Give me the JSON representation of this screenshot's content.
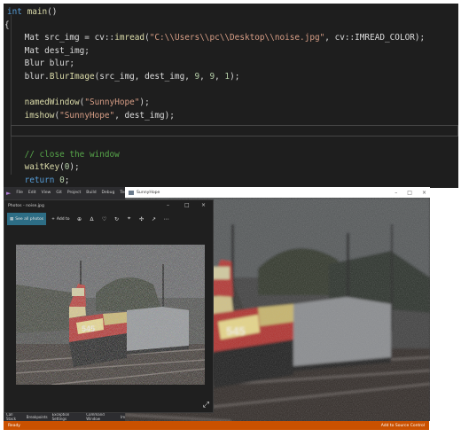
{
  "editor": {
    "lines": [
      {
        "toks": [
          [
            "kw",
            "int "
          ],
          [
            "fn",
            "main"
          ],
          [
            "txt",
            "()"
          ]
        ]
      },
      {
        "toks": [
          [
            "txt",
            "{"
          ]
        ]
      },
      {
        "toks": [
          [
            "txt",
            "    Mat src_img = cv::"
          ],
          [
            "fn",
            "imread"
          ],
          [
            "txt",
            "("
          ],
          [
            "str",
            "\"C:\\\\Users\\\\pc\\\\Desktop\\\\noise.jpg\""
          ],
          [
            "txt",
            ", cv::IMREAD_COLOR);"
          ]
        ]
      },
      {
        "toks": [
          [
            "txt",
            "    Mat dest_img;"
          ]
        ]
      },
      {
        "toks": [
          [
            "txt",
            "    Blur blur;"
          ]
        ]
      },
      {
        "toks": [
          [
            "txt",
            "    blur."
          ],
          [
            "fn",
            "BlurImage"
          ],
          [
            "txt",
            "(src_img, dest_img, "
          ],
          [
            "num",
            "9"
          ],
          [
            "txt",
            ", "
          ],
          [
            "num",
            "9"
          ],
          [
            "txt",
            ", "
          ],
          [
            "num",
            "1"
          ],
          [
            "txt",
            ");"
          ]
        ]
      },
      {
        "toks": [
          [
            "txt",
            ""
          ]
        ]
      },
      {
        "toks": [
          [
            "txt",
            "    "
          ],
          [
            "fn",
            "namedWindow"
          ],
          [
            "txt",
            "("
          ],
          [
            "str",
            "\"SunnyHope\""
          ],
          [
            "txt",
            ");"
          ]
        ]
      },
      {
        "toks": [
          [
            "txt",
            "    "
          ],
          [
            "fn",
            "imshow"
          ],
          [
            "txt",
            "("
          ],
          [
            "str",
            "\"SunnyHope\""
          ],
          [
            "txt",
            ", dest_img);"
          ]
        ]
      },
      {
        "toks": [
          [
            "txt",
            ""
          ]
        ]
      },
      {
        "toks": [
          [
            "txt",
            ""
          ]
        ]
      },
      {
        "toks": [
          [
            "txt",
            "    "
          ],
          [
            "cm",
            "// close the window"
          ]
        ]
      },
      {
        "toks": [
          [
            "txt",
            "    "
          ],
          [
            "fn",
            "waitKey"
          ],
          [
            "txt",
            "("
          ],
          [
            "num",
            "0"
          ],
          [
            "txt",
            ");"
          ]
        ]
      },
      {
        "toks": [
          [
            "txt",
            "    "
          ],
          [
            "kw",
            "return "
          ],
          [
            "num",
            "0"
          ],
          [
            "txt",
            ";"
          ]
        ]
      },
      {
        "toks": [
          [
            "txt",
            "}"
          ]
        ]
      }
    ],
    "colors": {
      "background": "#1e1e1e",
      "keyword": "#569cd6",
      "function": "#dcdcaa",
      "string": "#d69d85",
      "comment": "#57a64a"
    }
  },
  "ide": {
    "menu": [
      "File",
      "Edit",
      "View",
      "Git",
      "Project",
      "Build",
      "Debug",
      "Test"
    ],
    "panel_tabs": [
      "Call Stack",
      "Breakpoints",
      "Exception Settings",
      "Command Window",
      "Imm"
    ],
    "status_left": "Ready",
    "status_right": "Add to Source Control",
    "status_color": "#ca5100"
  },
  "photos": {
    "title": "Photos - noise.jpg",
    "see_all": "See all photos",
    "add_to": "Add to",
    "toolbar_icons": [
      "zoom-icon",
      "delete-icon",
      "heart-icon",
      "rotate-icon",
      "crop-icon",
      "edit-icon",
      "share-icon",
      "more-icon"
    ],
    "accent": "#2d6d85"
  },
  "sunny": {
    "title": "SunnyHope",
    "locomotive_number": "545"
  }
}
